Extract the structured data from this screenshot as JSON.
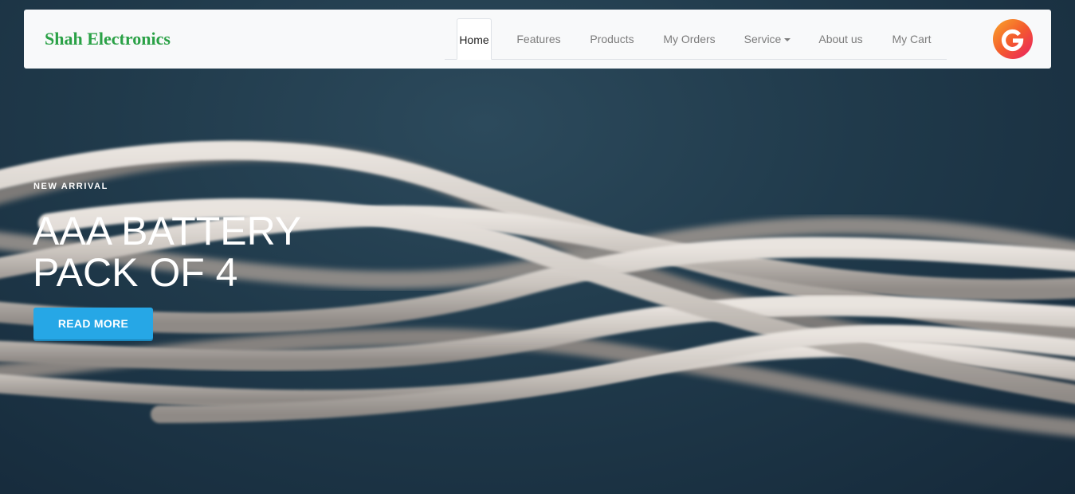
{
  "navbar": {
    "brand": "Shah Electronics",
    "items": [
      {
        "label": "Home",
        "active": true
      },
      {
        "label": "Features"
      },
      {
        "label": "Products"
      },
      {
        "label": "My Orders"
      },
      {
        "label": "Service",
        "dropdown": true
      },
      {
        "label": "About us"
      },
      {
        "label": "My Cart"
      }
    ],
    "logo_icon": "google-g-icon"
  },
  "hero": {
    "eyebrow": "NEW ARRIVAL",
    "title_line1": "AAA BATTERY",
    "title_line2": "PACK OF 4",
    "button_label": "READ MORE",
    "background_image": "twisted-white-cables"
  },
  "colors": {
    "brand_green": "#2aa146",
    "button_blue": "#26a7e6",
    "hero_background": "#1c3444",
    "navbar_background": "#f8f9fa"
  }
}
